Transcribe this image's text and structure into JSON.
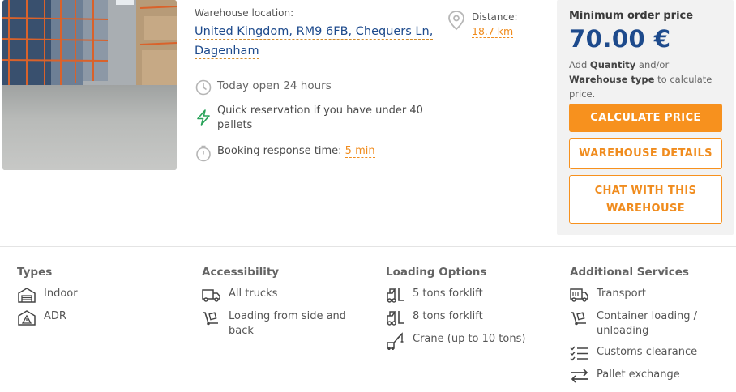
{
  "listing": {
    "location_label": "Warehouse location:",
    "address_line1": "United Kingdom, RM9 6FB, Chequers Ln,",
    "address_line2": "Dagenham",
    "distance_label": "Distance:",
    "distance_value": "18.7 km",
    "hours": "Today open 24 hours",
    "quick_reservation": "Quick reservation if you have under 40 pallets",
    "booking_label": "Booking response time:",
    "booking_value": "5 min"
  },
  "price": {
    "title": "Minimum order price",
    "amount": "70.00 €",
    "hint_prefix": "Add",
    "hint_quantity": "Quantity",
    "hint_mid": "and/or",
    "hint_type": "Warehouse type",
    "hint_suffix": "to calculate price.",
    "calculate_label": "CALCULATE PRICE",
    "details_label": "WAREHOUSE DETAILS",
    "chat_label": "CHAT WITH THIS WAREHOUSE"
  },
  "features": {
    "types": {
      "title": "Types",
      "items": [
        {
          "label": "Indoor",
          "icon": "warehouse-icon"
        },
        {
          "label": "ADR",
          "icon": "hazard-icon"
        }
      ]
    },
    "accessibility": {
      "title": "Accessibility",
      "items": [
        {
          "label": "All trucks",
          "icon": "truck-icon"
        },
        {
          "label": "Loading from side and back",
          "icon": "hand-truck-icon"
        }
      ]
    },
    "loading": {
      "title": "Loading Options",
      "items": [
        {
          "label": "5 tons forklift",
          "icon": "forklift-icon"
        },
        {
          "label": "8 tons forklift",
          "icon": "forklift-icon"
        },
        {
          "label": "Crane (up to 10 tons)",
          "icon": "crane-icon"
        }
      ]
    },
    "services": {
      "title": "Additional Services",
      "items": [
        {
          "label": "Transport",
          "icon": "truck-icon"
        },
        {
          "label": "Container loading / unloading",
          "icon": "hand-truck-icon"
        },
        {
          "label": "Customs clearance",
          "icon": "checklist-icon"
        },
        {
          "label": "Pallet exchange",
          "icon": "exchange-icon"
        }
      ]
    }
  },
  "colors": {
    "accent": "#f7911e",
    "link": "#1d4a8c",
    "quick_icon": "#2aa35a"
  }
}
